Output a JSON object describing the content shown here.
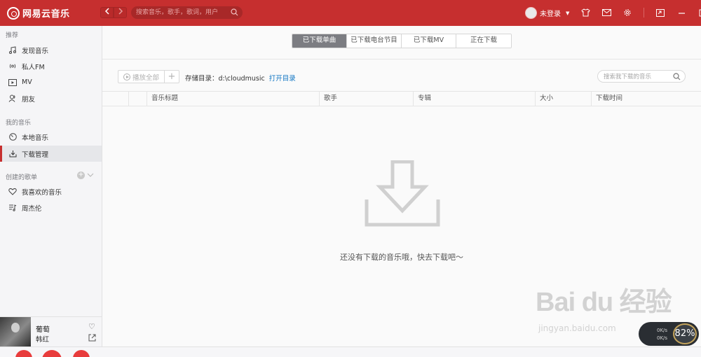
{
  "app": {
    "title": "网易云音乐",
    "accent_color": "#c62f2f"
  },
  "topbar": {
    "back_icon": "chevron-left-icon",
    "forward_icon": "chevron-right-icon",
    "search_placeholder": "搜索音乐，歌手，歌词，用户",
    "user_label": "未登录",
    "icons": [
      "shirt-icon",
      "mail-icon",
      "gear-icon",
      "mini-mode-icon",
      "minimize-icon",
      "maximize-icon",
      "close-icon"
    ]
  },
  "sidebar": {
    "section_recommend": "推荐",
    "recommend_items": [
      {
        "label": "发现音乐",
        "icon": "music-note-icon"
      },
      {
        "label": "私人FM",
        "icon": "radio-icon"
      },
      {
        "label": "MV",
        "icon": "video-icon"
      },
      {
        "label": "朋友",
        "icon": "friends-icon"
      }
    ],
    "section_my_music": "我的音乐",
    "my_music_items": [
      {
        "label": "本地音乐",
        "icon": "disc-icon"
      },
      {
        "label": "下载管理",
        "icon": "download-icon",
        "active": true
      }
    ],
    "section_created": "创建的歌单",
    "created_items": [
      {
        "label": "我喜欢的音乐",
        "icon": "heart-icon"
      },
      {
        "label": "周杰伦",
        "icon": "playlist-icon"
      }
    ]
  },
  "now_playing": {
    "title": "葡萄",
    "artist": "韩红"
  },
  "main": {
    "tabs": [
      "已下载单曲",
      "已下载电台节目",
      "已下载MV",
      "正在下载"
    ],
    "active_tab": 0,
    "play_all_label": "播放全部",
    "storage_label": "存储目录：d:\\cloudmusic",
    "open_dir_label": "打开目录",
    "search_placeholder": "搜索我下载的音乐",
    "columns": [
      "音乐标题",
      "歌手",
      "专辑",
      "大小",
      "下载时间"
    ],
    "empty_text": "还没有下载的音乐哦，快去下载吧～"
  },
  "watermark": {
    "brand": "Bai du 经验",
    "url": "jingyan.baidu.com"
  },
  "speed_widget": {
    "up_rate": "0K/s",
    "down_rate": "0K/s",
    "percent": "82%"
  }
}
